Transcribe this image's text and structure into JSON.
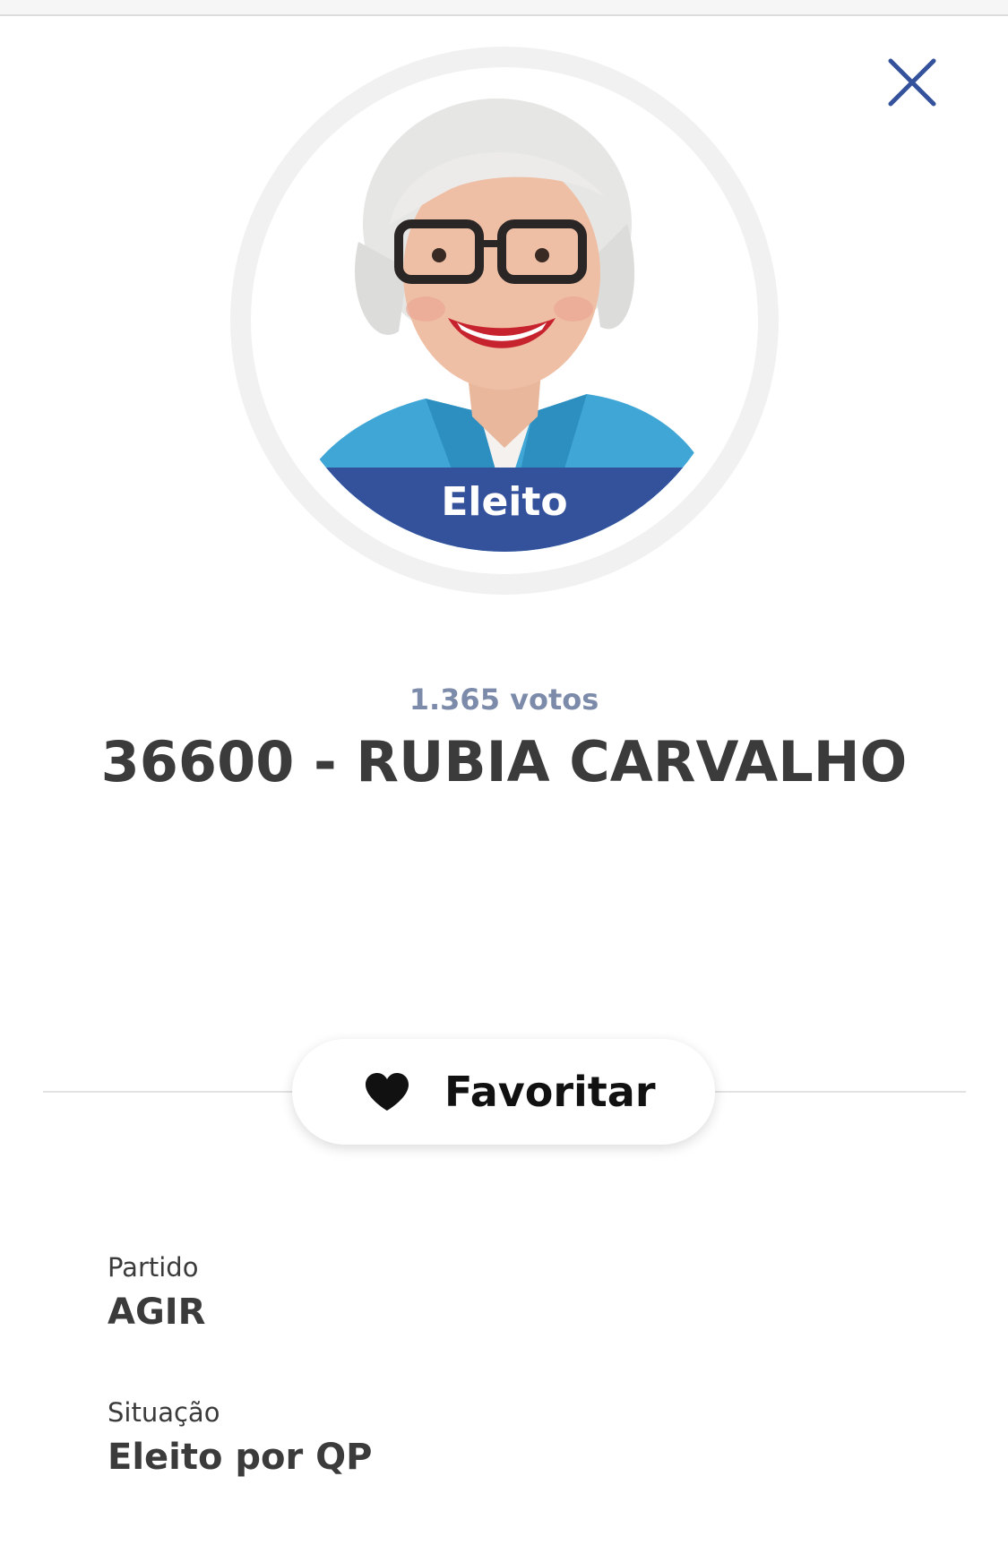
{
  "modal": {
    "close_icon": "close-icon"
  },
  "candidate": {
    "status_badge": "Eleito",
    "votes": "1.365 votos",
    "title": "36600 - RUBIA CARVALHO"
  },
  "actions": {
    "favorite_label": "Favoritar",
    "favorite_icon": "heart-icon"
  },
  "details": [
    {
      "label": "Partido",
      "value": "AGIR"
    },
    {
      "label": "Situação",
      "value": "Eleito por QP"
    }
  ],
  "colors": {
    "accent": "#34519c",
    "votes_text": "#7d8bab",
    "text": "#3b3b3b"
  }
}
